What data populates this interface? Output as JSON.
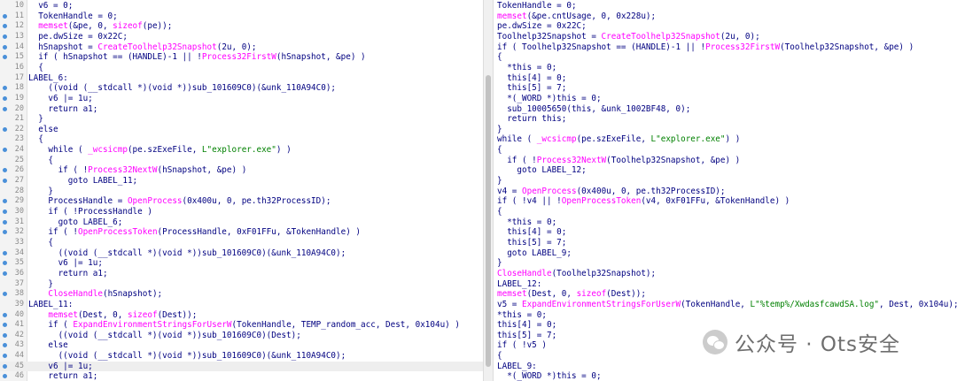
{
  "left_pane": {
    "lines": [
      {
        "n": "10",
        "dot": false,
        "t": "  v6 = 0;"
      },
      {
        "n": "11",
        "dot": true,
        "t": "  TokenHandle = 0;"
      },
      {
        "n": "12",
        "dot": true,
        "t": "  memset(&pe, 0, sizeof(pe));"
      },
      {
        "n": "13",
        "dot": true,
        "t": "  pe.dwSize = 0x22C;"
      },
      {
        "n": "14",
        "dot": true,
        "t": "  hSnapshot = CreateToolhelp32Snapshot(2u, 0);"
      },
      {
        "n": "15",
        "dot": true,
        "t": "  if ( hSnapshot == (HANDLE)-1 || !Process32FirstW(hSnapshot, &pe) )"
      },
      {
        "n": "16",
        "dot": false,
        "t": "  {"
      },
      {
        "n": "17",
        "dot": false,
        "t": "LABEL_6:"
      },
      {
        "n": "18",
        "dot": true,
        "t": "    ((void (__stdcall *)(void *))sub_101609C0)(&unk_110A94C0);"
      },
      {
        "n": "19",
        "dot": true,
        "t": "    v6 |= 1u;"
      },
      {
        "n": "20",
        "dot": true,
        "t": "    return a1;"
      },
      {
        "n": "21",
        "dot": false,
        "t": "  }"
      },
      {
        "n": "22",
        "dot": true,
        "t": "  else"
      },
      {
        "n": "23",
        "dot": false,
        "t": "  {"
      },
      {
        "n": "24",
        "dot": true,
        "t": "    while ( _wcsicmp(pe.szExeFile, L\"explorer.exe\") )"
      },
      {
        "n": "25",
        "dot": false,
        "t": "    {"
      },
      {
        "n": "26",
        "dot": true,
        "t": "      if ( !Process32NextW(hSnapshot, &pe) )"
      },
      {
        "n": "27",
        "dot": true,
        "t": "        goto LABEL_11;"
      },
      {
        "n": "28",
        "dot": false,
        "t": "    }"
      },
      {
        "n": "29",
        "dot": true,
        "t": "    ProcessHandle = OpenProcess(0x400u, 0, pe.th32ProcessID);"
      },
      {
        "n": "30",
        "dot": true,
        "t": "    if ( !ProcessHandle )"
      },
      {
        "n": "31",
        "dot": true,
        "t": "      goto LABEL_6;"
      },
      {
        "n": "32",
        "dot": true,
        "t": "    if ( !OpenProcessToken(ProcessHandle, 0xF01FFu, &TokenHandle) )"
      },
      {
        "n": "33",
        "dot": false,
        "t": "    {"
      },
      {
        "n": "34",
        "dot": true,
        "t": "      ((void (__stdcall *)(void *))sub_101609C0)(&unk_110A94C0);"
      },
      {
        "n": "35",
        "dot": true,
        "t": "      v6 |= 1u;"
      },
      {
        "n": "36",
        "dot": true,
        "t": "      return a1;"
      },
      {
        "n": "37",
        "dot": false,
        "t": "    }"
      },
      {
        "n": "38",
        "dot": true,
        "t": "    CloseHandle(hSnapshot);"
      },
      {
        "n": "39",
        "dot": false,
        "t": "LABEL_11:"
      },
      {
        "n": "40",
        "dot": true,
        "t": "    memset(Dest, 0, sizeof(Dest));"
      },
      {
        "n": "41",
        "dot": true,
        "t": "    if ( ExpandEnvironmentStringsForUserW(TokenHandle, TEMP_random_acc, Dest, 0x104u) )"
      },
      {
        "n": "42",
        "dot": true,
        "t": "      ((void (__stdcall *)(void *))sub_101609C0)(Dest);"
      },
      {
        "n": "43",
        "dot": true,
        "t": "    else"
      },
      {
        "n": "44",
        "dot": true,
        "t": "      ((void (__stdcall *)(void *))sub_101609C0)(&unk_110A94C0);"
      },
      {
        "n": "45",
        "dot": true,
        "t": "    v6 |= 1u;"
      },
      {
        "n": "46",
        "dot": true,
        "t": "    return a1;"
      }
    ]
  },
  "right_pane": {
    "lines": [
      {
        "t": "TokenHandle = 0;"
      },
      {
        "t": "memset(&pe.cntUsage, 0, 0x228u);"
      },
      {
        "t": "pe.dwSize = 0x22C;"
      },
      {
        "t": "Toolhelp32Snapshot = CreateToolhelp32Snapshot(2u, 0);"
      },
      {
        "t": "if ( Toolhelp32Snapshot == (HANDLE)-1 || !Process32FirstW(Toolhelp32Snapshot, &pe) )"
      },
      {
        "t": "{"
      },
      {
        "t": "  *this = 0;"
      },
      {
        "t": "  this[4] = 0;"
      },
      {
        "t": "  this[5] = 7;"
      },
      {
        "t": "  *(_WORD *)this = 0;"
      },
      {
        "t": "  sub_10005650(this, &unk_1002BF48, 0);"
      },
      {
        "t": "  return this;"
      },
      {
        "t": "}"
      },
      {
        "t": "while ( _wcsicmp(pe.szExeFile, L\"explorer.exe\") )"
      },
      {
        "t": "{"
      },
      {
        "t": "  if ( !Process32NextW(Toolhelp32Snapshot, &pe) )"
      },
      {
        "t": "    goto LABEL_12;"
      },
      {
        "t": "}"
      },
      {
        "t": "v4 = OpenProcess(0x400u, 0, pe.th32ProcessID);"
      },
      {
        "t": "if ( !v4 || !OpenProcessToken(v4, 0xF01FFu, &TokenHandle) )"
      },
      {
        "t": "{"
      },
      {
        "t": "  *this = 0;"
      },
      {
        "t": "  this[4] = 0;"
      },
      {
        "t": "  this[5] = 7;"
      },
      {
        "t": "  goto LABEL_9;"
      },
      {
        "t": "}"
      },
      {
        "t": "CloseHandle(Toolhelp32Snapshot);"
      },
      {
        "t": "LABEL_12:"
      },
      {
        "t": "memset(Dest, 0, sizeof(Dest));"
      },
      {
        "t": "v5 = ExpandEnvironmentStringsForUserW(TokenHandle, L\"%temp%/XwdasfcawdSA.log\", Dest, 0x104u);"
      },
      {
        "t": "*this = 0;"
      },
      {
        "t": "this[4] = 0;"
      },
      {
        "t": "this[5] = 7;"
      },
      {
        "t": "if ( !v5 )"
      },
      {
        "t": "{"
      },
      {
        "t": "LABEL_9:"
      },
      {
        "t": "  *(_WORD *)this = 0;"
      }
    ]
  },
  "watermark": {
    "icon": "wechat-icon",
    "text": "公众号 · Ots安全"
  },
  "colors": {
    "keyword": "#000080",
    "function": "#ff00ff",
    "string": "#008000",
    "highlight": "#eeeeee"
  }
}
